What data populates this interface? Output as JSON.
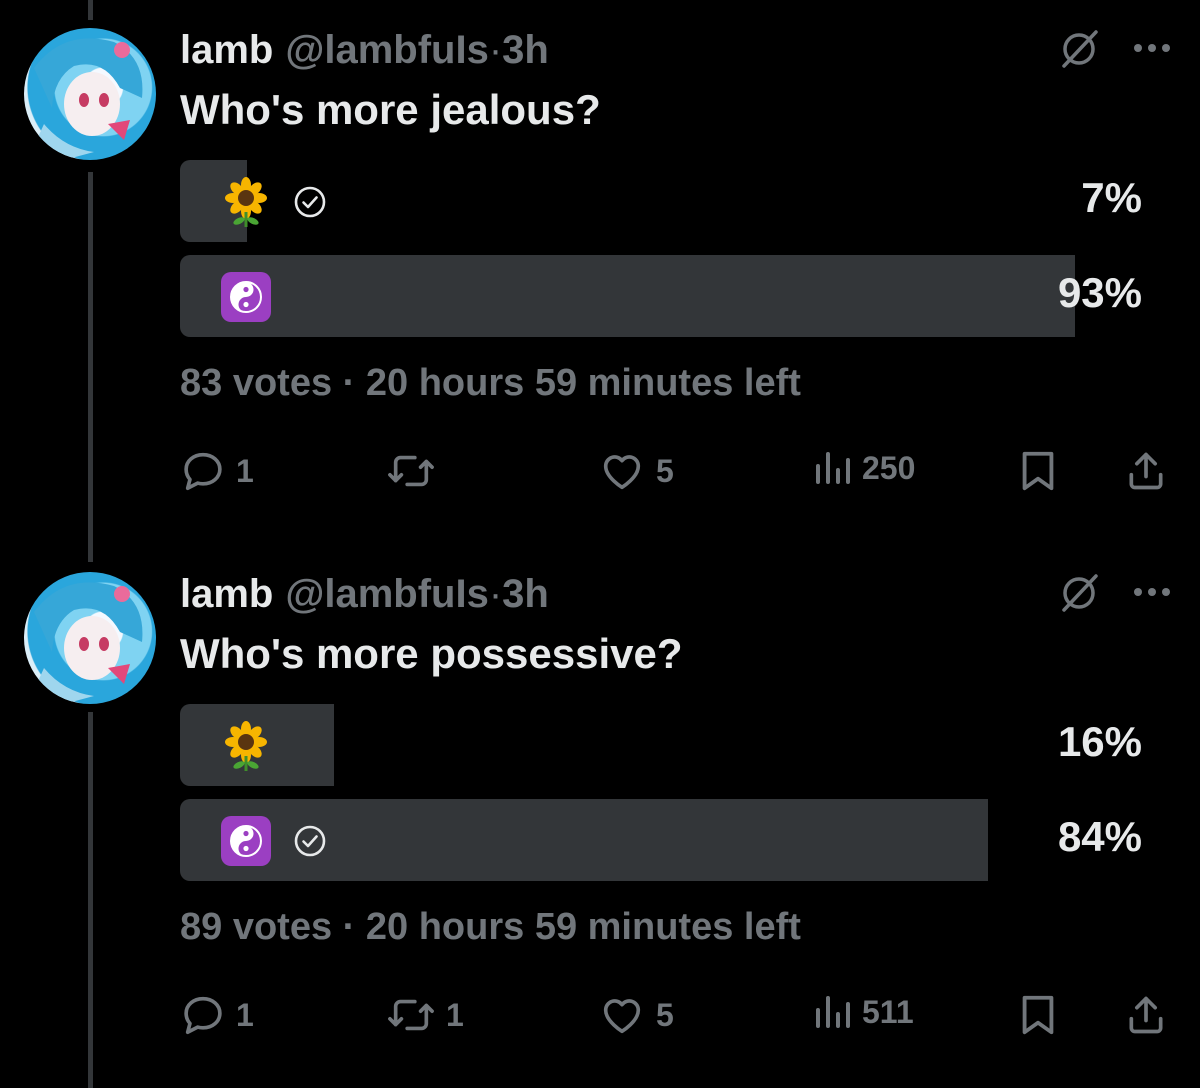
{
  "tweets": [
    {
      "author": {
        "name": "lamb",
        "handle": "@lambfuIs",
        "time": "3h",
        "separator": "·"
      },
      "text": "Who's more jealous?",
      "poll": {
        "options": [
          {
            "emoji": "sunflower",
            "percent_label": "7%",
            "percent": 7,
            "voted": true
          },
          {
            "emoji": "yin-yang",
            "percent_label": "93%",
            "percent": 93,
            "voted": false
          }
        ],
        "votes_label": "83 votes",
        "separator": "·",
        "time_left": "20 hours 59 minutes left"
      },
      "actions": {
        "replies": "1",
        "reposts": "",
        "likes": "5",
        "views": "250"
      }
    },
    {
      "author": {
        "name": "lamb",
        "handle": "@lambfuIs",
        "time": "3h",
        "separator": "·"
      },
      "text": "Who's more possessive?",
      "poll": {
        "options": [
          {
            "emoji": "sunflower",
            "percent_label": "16%",
            "percent": 16,
            "voted": false
          },
          {
            "emoji": "yin-yang",
            "percent_label": "84%",
            "percent": 84,
            "voted": true
          }
        ],
        "votes_label": "89 votes",
        "separator": "·",
        "time_left": "20 hours 59 minutes left"
      },
      "actions": {
        "replies": "1",
        "reposts": "1",
        "likes": "5",
        "views": "511"
      }
    }
  ],
  "colors": {
    "background": "#000000",
    "muted": "#71767b",
    "poll_bar": "#333639",
    "text": "#e7e9ea",
    "yin_yang_tile": "#9b3fc2"
  }
}
